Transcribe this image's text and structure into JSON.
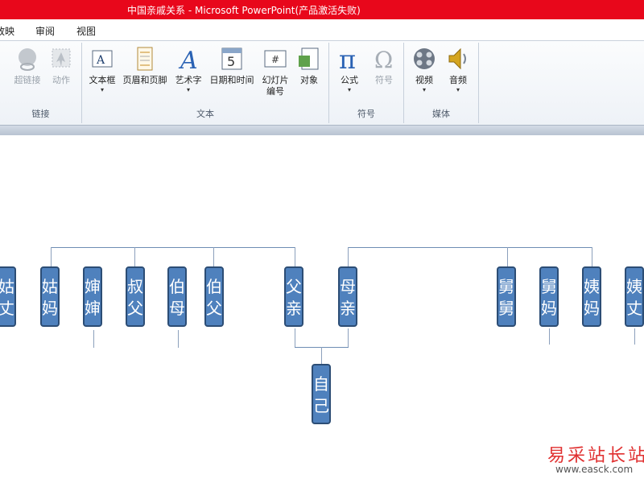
{
  "window": {
    "title": "中国亲戚关系  -  Microsoft PowerPoint(产品激活失败)"
  },
  "tabs": [
    {
      "label": "放映"
    },
    {
      "label": "审阅"
    },
    {
      "label": "视图"
    }
  ],
  "ribbon": {
    "groups": [
      {
        "label": "链接",
        "buttons": [
          {
            "label": "超链接",
            "icon": "hyperlink-icon"
          },
          {
            "label": "动作",
            "icon": "action-icon"
          }
        ]
      },
      {
        "label": "文本",
        "buttons": [
          {
            "label": "文本框",
            "icon": "textbox-icon"
          },
          {
            "label": "页眉和页脚",
            "icon": "header-footer-icon"
          },
          {
            "label": "艺术字",
            "icon": "wordart-icon"
          },
          {
            "label": "日期和时间",
            "icon": "date-time-icon"
          },
          {
            "label": "幻灯片编号",
            "icon": "slide-number-icon"
          },
          {
            "label": "对象",
            "icon": "object-icon"
          }
        ]
      },
      {
        "label": "符号",
        "buttons": [
          {
            "label": "公式",
            "icon": "equation-icon"
          },
          {
            "label": "符号",
            "icon": "omega-icon"
          }
        ]
      },
      {
        "label": "媒体",
        "buttons": [
          {
            "label": "视频",
            "icon": "video-icon"
          },
          {
            "label": "音频",
            "icon": "audio-icon"
          }
        ]
      }
    ]
  },
  "slide": {
    "nodes": [
      {
        "label": "姑丈"
      },
      {
        "label": "姑妈"
      },
      {
        "label": "婶婶"
      },
      {
        "label": "叔父"
      },
      {
        "label": "伯母"
      },
      {
        "label": "伯父"
      },
      {
        "label": "父亲"
      },
      {
        "label": "母亲"
      },
      {
        "label": "自己"
      },
      {
        "label": "舅舅"
      },
      {
        "label": "舅妈"
      },
      {
        "label": "姨妈"
      },
      {
        "label": "姨丈"
      }
    ]
  },
  "watermark": {
    "text": "易采站长站",
    "url": "www.easck.com"
  }
}
